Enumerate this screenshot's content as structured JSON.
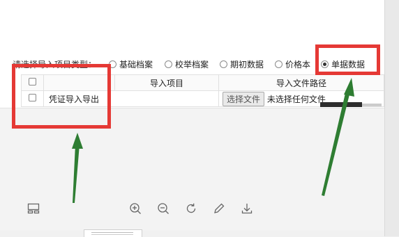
{
  "import_form": {
    "type_prompt": "请选择导入项目类型：",
    "type_options": [
      "基础档案",
      "校举档案",
      "期初数据",
      "价格本",
      "单据数据"
    ],
    "selected_option": "单据数据",
    "table": {
      "headers": [
        "",
        "",
        "导入项目",
        "导入文件路径"
      ],
      "rows": [
        {
          "item": "凭证导入导出",
          "file_button": "选择文件",
          "file_status": "未选择任何文件"
        }
      ]
    }
  },
  "annotations": {
    "highlight_color": "#e53935",
    "arrow_color": "#2e7d32"
  },
  "toolbar": {
    "icons": [
      "layout-icon",
      "zoom-in-icon",
      "zoom-out-icon",
      "rotate-icon",
      "edit-icon",
      "download-icon"
    ]
  }
}
